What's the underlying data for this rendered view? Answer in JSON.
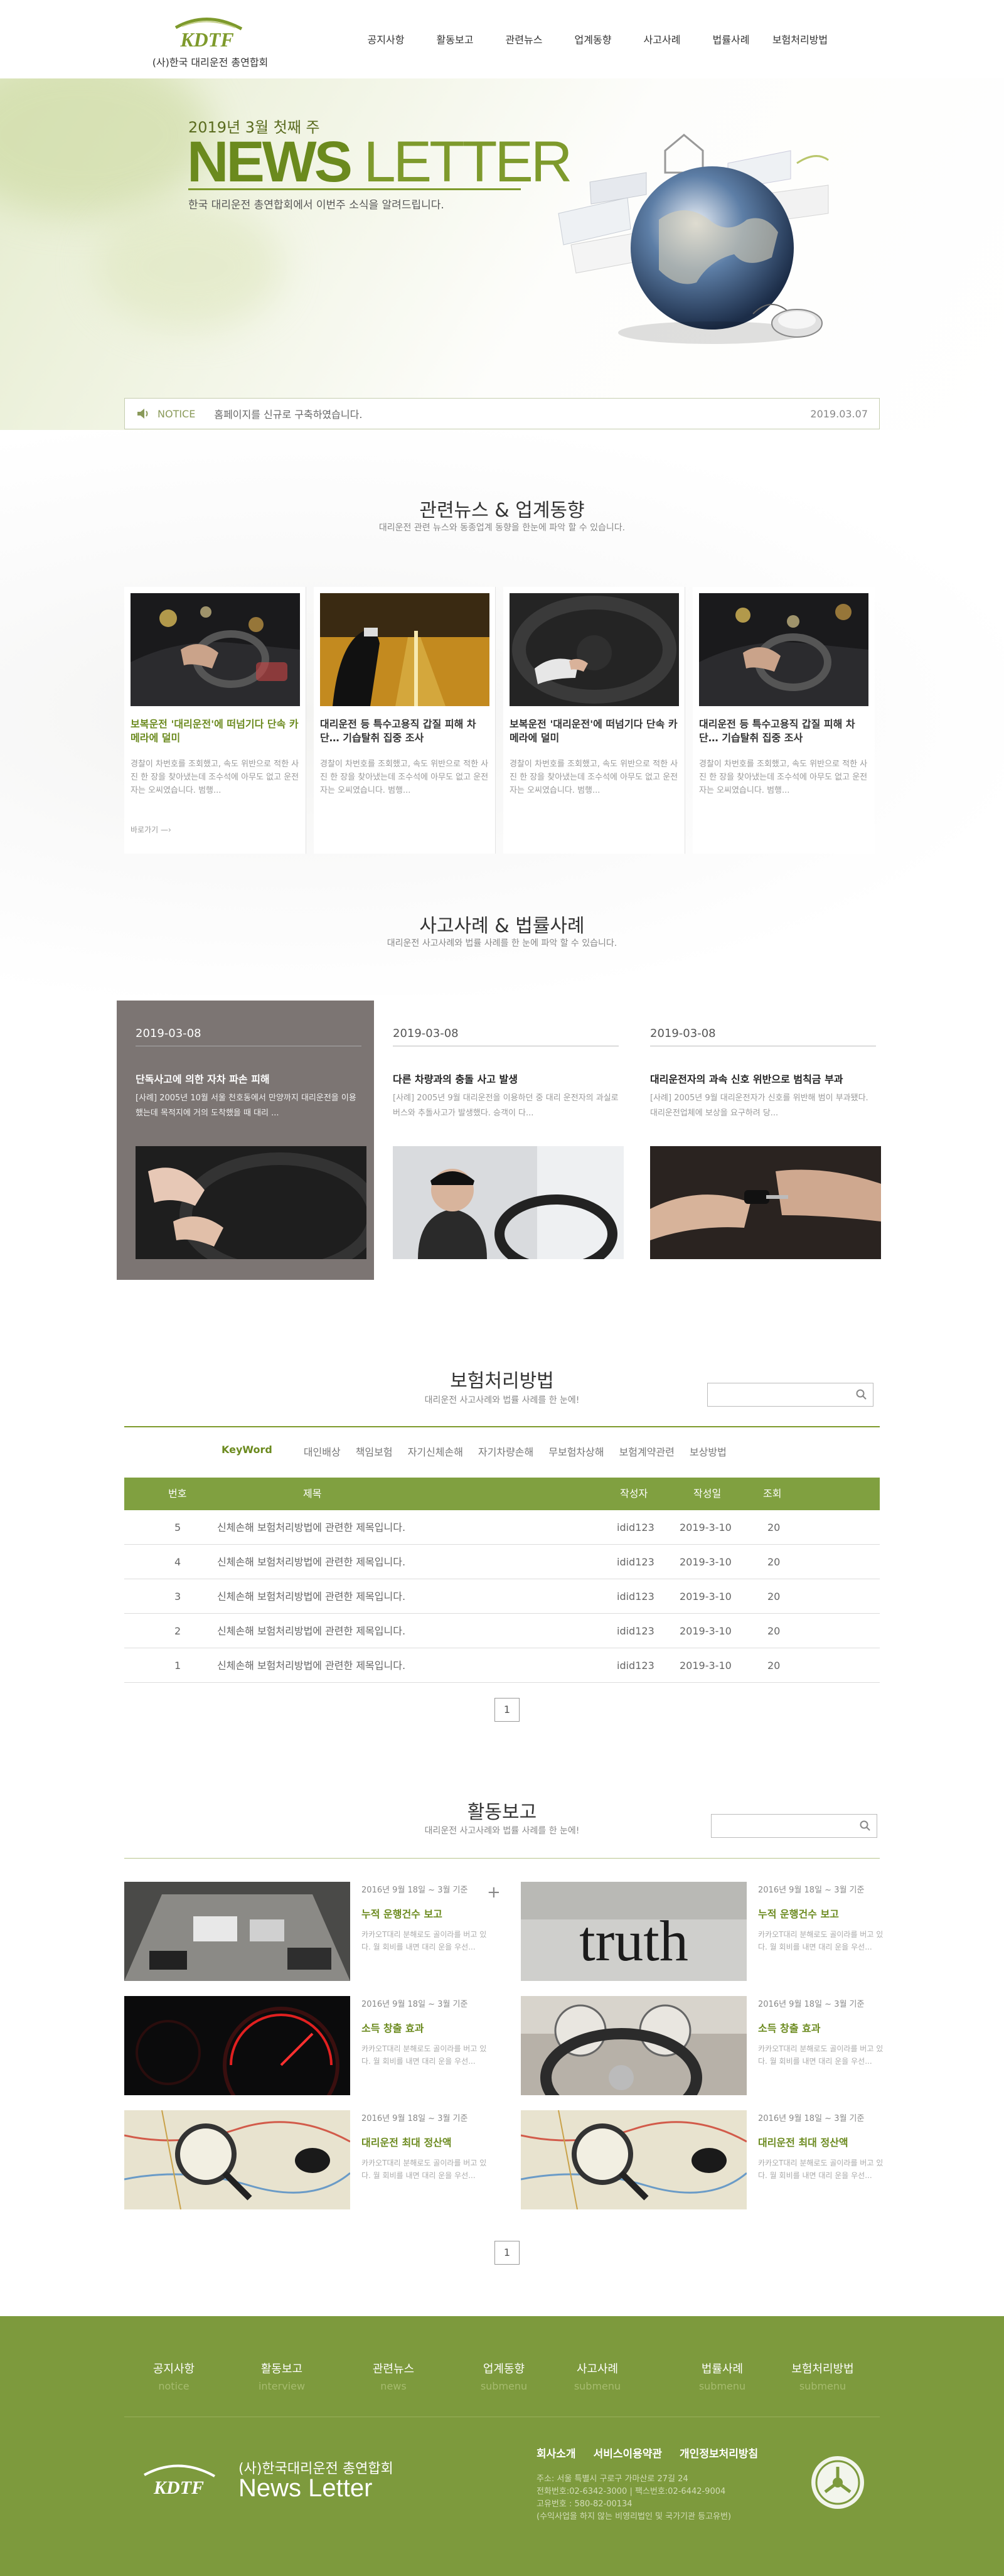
{
  "header": {
    "logo_text": "KDTF",
    "org_name": "(사)한국 대리운전 총연합회",
    "nav": [
      "공지사항",
      "활동보고",
      "관련뉴스",
      "업계동향",
      "사고사례",
      "법률사례",
      "보험처리방법"
    ]
  },
  "hero": {
    "date": "2019년 3월 첫째 주",
    "title_bold": "NEWS",
    "title_light": " LETTER",
    "subtitle": "한국 대리운전 총연합회에서 이번주 소식을 알려드립니다."
  },
  "notice": {
    "label": "NOTICE",
    "text": "홈페이지를 신규로 구축하였습니다.",
    "date": "2019.03.07"
  },
  "news": {
    "title": "관련뉴스 & 업계동향",
    "subtitle": "대리운전 관련 뉴스와 동종업계 동향을 한눈에 파악 할 수 있습니다.",
    "more_label": "바로가기",
    "cards": [
      {
        "title": "보복운전 '대리운전'에 떠넘기다 단속 카메라에 덜미",
        "text": "경찰이 차번호를 조회했고, 속도 위반으로 적한 사진 한 장을 찾아냈는데 조수석에 아무도 없고 운전자는 오씨였습니다. 범행..."
      },
      {
        "title": "대리운전 등 특수고용직 갑질 피해 차단… 기습탈취 집중 조사",
        "text": "경찰이 차번호를 조회했고, 속도 위반으로 적한 사진 한 장을 찾아냈는데 조수석에 아무도 없고 운전자는 오씨였습니다. 범행..."
      },
      {
        "title": "보복운전 '대리운전'에 떠넘기다 단속 카메라에 덜미",
        "text": "경찰이 차번호를 조회했고, 속도 위반으로 적한 사진 한 장을 찾아냈는데 조수석에 아무도 없고 운전자는 오씨였습니다. 범행..."
      },
      {
        "title": "대리운전 등 특수고용직 갑질 피해 차단… 기습탈취 집중 조사",
        "text": "경찰이 차번호를 조회했고, 속도 위반으로 적한 사진 한 장을 찾아냈는데 조수석에 아무도 없고 운전자는 오씨였습니다. 범행..."
      }
    ]
  },
  "cases": {
    "title": "사고사례 & 법률사례",
    "subtitle": "대리운전 사고사례와 법률 사례를 한 눈에 파악 할 수 있습니다.",
    "items": [
      {
        "date": "2019-03-08",
        "title": "단독사고에 의한 자차 파손 피해",
        "text": "[사례] 2005년 10월 서울 천호동에서 만양까지 대리운전을 이용했는데 목적지에 거의 도착했을 때 대리 ..."
      },
      {
        "date": "2019-03-08",
        "title": "다른 차량과의 충돌 사고 발생",
        "text": "[사례] 2005년 9월 대리운전을 이용하던 중 대리 운전자의 과실로 버스와 추돌사고가 발생했다. 승객이 다..."
      },
      {
        "date": "2019-03-08",
        "title": "대리운전자의 과속 신호 위반으로 범칙금 부과",
        "text": "[사례] 2005년 9월 대리운전자가 신호를 위반해 범이 부과됐다. 대리운전업체에 보상을 요구하려 당..."
      }
    ]
  },
  "insurance": {
    "title": "보험처리방법",
    "subtitle": "대리운전 사고사례와 법률 사례를 한 눈에!",
    "keyword_label": "KeyWord",
    "keywords": [
      "대인배상",
      "책임보험",
      "자기신체손해",
      "자기차량손해",
      "무보험차상해",
      "보험계약관련",
      "보상방법"
    ],
    "columns": [
      "번호",
      "제목",
      "작성자",
      "작성일",
      "조회"
    ],
    "rows": [
      [
        "5",
        "신체손해 보험처리방법에 관련한 제목입니다.",
        "idid123",
        "2019-3-10",
        "20"
      ],
      [
        "4",
        "신체손해 보험처리방법에 관련한 제목입니다.",
        "idid123",
        "2019-3-10",
        "20"
      ],
      [
        "3",
        "신체손해 보험처리방법에 관련한 제목입니다.",
        "idid123",
        "2019-3-10",
        "20"
      ],
      [
        "2",
        "신체손해 보험처리방법에 관련한 제목입니다.",
        "idid123",
        "2019-3-10",
        "20"
      ],
      [
        "1",
        "신체손해 보험처리방법에 관련한 제목입니다.",
        "idid123",
        "2019-3-10",
        "20"
      ]
    ],
    "page": "1"
  },
  "activity": {
    "title": "활동보고",
    "subtitle": "대리운전 사고사례와 법률 사례를 한 눈에!",
    "items": [
      {
        "date": "2016년 9월 18일 ~ 3월 기준",
        "title": "누적 운행건수 보고",
        "text": "카카오T대리 분해로도 골이라를 버고 있다. 월 회비를 내면 대리 운을 우선..."
      },
      {
        "date": "2016년 9월 18일 ~ 3월 기준",
        "title": "누적 운행건수 보고",
        "text": "카카오T대리 분해로도 골이라를 버고 있다. 월 회비를 내면 대리 운을 우선..."
      },
      {
        "date": "2016년 9월 18일 ~ 3월 기준",
        "title": "소득 창출 효과",
        "text": "카카오T대리 분해로도 골이라를 버고 있다. 월 회비를 내면 대리 운을 우선..."
      },
      {
        "date": "2016년 9월 18일 ~ 3월 기준",
        "title": "소득 창출 효과",
        "text": "카카오T대리 분해로도 골이라를 버고 있다. 월 회비를 내면 대리 운을 우선..."
      },
      {
        "date": "2016년 9월 18일 ~ 3월 기준",
        "title": "대리운전 최대 정산액",
        "text": "카카오T대리 분해로도 골이라를 버고 있다. 월 회비를 내면 대리 운을 우선..."
      },
      {
        "date": "2016년 9월 18일 ~ 3월 기준",
        "title": "대리운전 최대 정산액",
        "text": "카카오T대리 분해로도 골이라를 버고 있다. 월 회비를 내면 대리 운을 우선..."
      }
    ],
    "truth_word": "truth",
    "page": "1"
  },
  "footer": {
    "nav": [
      {
        "ko": "공지사항",
        "en": "notice"
      },
      {
        "ko": "활동보고",
        "en": "interview"
      },
      {
        "ko": "관련뉴스",
        "en": "news"
      },
      {
        "ko": "업계동향",
        "en": "submenu"
      },
      {
        "ko": "사고사례",
        "en": "submenu"
      },
      {
        "ko": "법률사례",
        "en": "submenu"
      },
      {
        "ko": "보험처리방법",
        "en": "submenu"
      }
    ],
    "logo_text": "KDTF",
    "org": "(사)한국대리운전 총연합회",
    "newsletter": "News Letter",
    "links": [
      "회사소개",
      "서비스이용약관",
      "개인정보처리방침"
    ],
    "address": [
      "주소: 서울 특별시 구로구 가마산로 27길 24",
      "전화번호:02-6342-3000 | 팩스번호:02-6442-9004",
      "고유번호 : 580-82-00134",
      "(수익사업을 하지 않는 비영리법인 및 국가기관 등고유번)"
    ]
  },
  "colors": {
    "brand_green": "#7e9a2c",
    "footer_green": "#7d9a3d",
    "case_active_bg": "#7c7573"
  }
}
